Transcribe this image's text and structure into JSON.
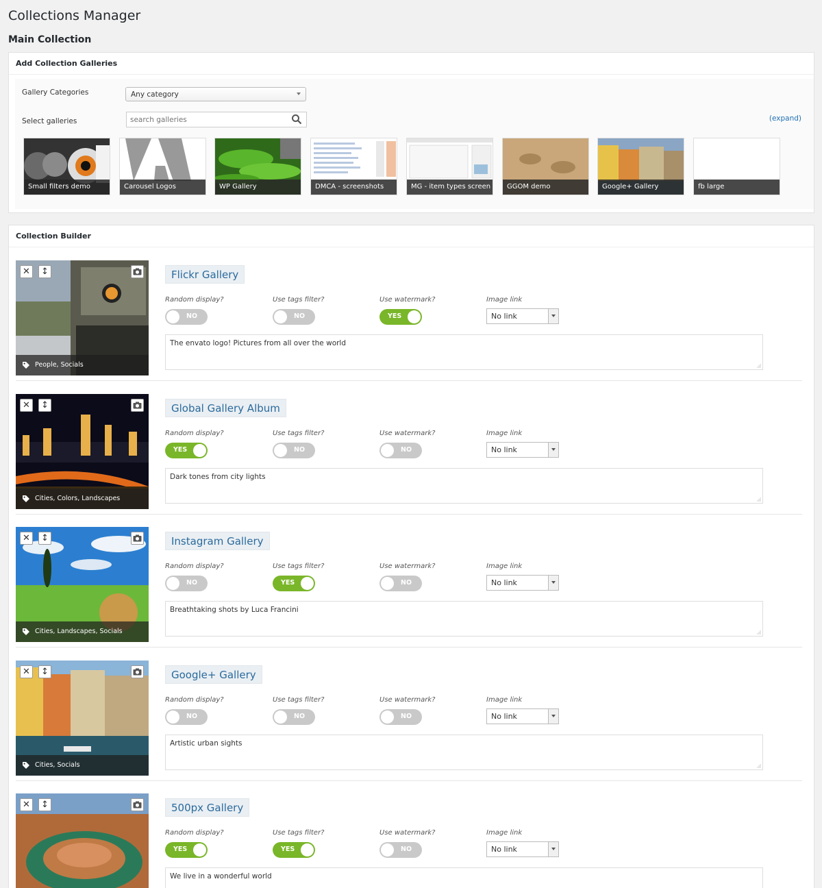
{
  "page": {
    "title": "Collections Manager",
    "subtitle": "Main Collection"
  },
  "add_box": {
    "header": "Add Collection Galleries",
    "categories_label": "Gallery Categories",
    "category_selected": "Any category",
    "select_label": "Select galleries",
    "search_placeholder": "search galleries",
    "expand_label": "(expand)",
    "galleries": [
      {
        "name": "Small filters demo"
      },
      {
        "name": "Carousel Logos"
      },
      {
        "name": "WP Gallery"
      },
      {
        "name": "DMCA - screenshots"
      },
      {
        "name": "MG - item types screen"
      },
      {
        "name": "GGOM demo"
      },
      {
        "name": "Google+ Gallery"
      },
      {
        "name": "fb large"
      }
    ]
  },
  "builder": {
    "header": "Collection Builder",
    "field_labels": {
      "random": "Random display?",
      "tags": "Use tags filter?",
      "watermark": "Use watermark?",
      "link": "Image link"
    },
    "yes": "YES",
    "no": "NO",
    "items": [
      {
        "title": "Flickr Gallery",
        "tags": "People, Socials",
        "random": false,
        "tags_filter": false,
        "watermark": true,
        "link": "No link",
        "description": "The envato logo! Pictures from all over the world"
      },
      {
        "title": "Global Gallery Album",
        "tags": "Cities, Colors, Landscapes",
        "random": true,
        "tags_filter": false,
        "watermark": false,
        "link": "No link",
        "description": "Dark tones from city lights"
      },
      {
        "title": "Instagram Gallery",
        "tags": "Cities, Landscapes, Socials",
        "random": false,
        "tags_filter": true,
        "watermark": false,
        "link": "No link",
        "description": "Breathtaking shots by Luca Francini"
      },
      {
        "title": "Google+ Gallery",
        "tags": "Cities, Socials",
        "random": false,
        "tags_filter": false,
        "watermark": false,
        "link": "No link",
        "description": "Artistic urban sights"
      },
      {
        "title": "500px Gallery",
        "tags": "",
        "random": true,
        "tags_filter": true,
        "watermark": false,
        "link": "No link",
        "description": "We live in a wonderful world"
      }
    ]
  },
  "icons": {
    "remove": "close-icon",
    "move": "move-icon",
    "image": "camera-icon",
    "tag": "tag-icon",
    "search": "search-icon"
  },
  "colors": {
    "toggle_on": "#7ab629",
    "toggle_off": "#c9c9c9",
    "title_link": "#2a6a9c",
    "expand_link": "#2271b1"
  }
}
